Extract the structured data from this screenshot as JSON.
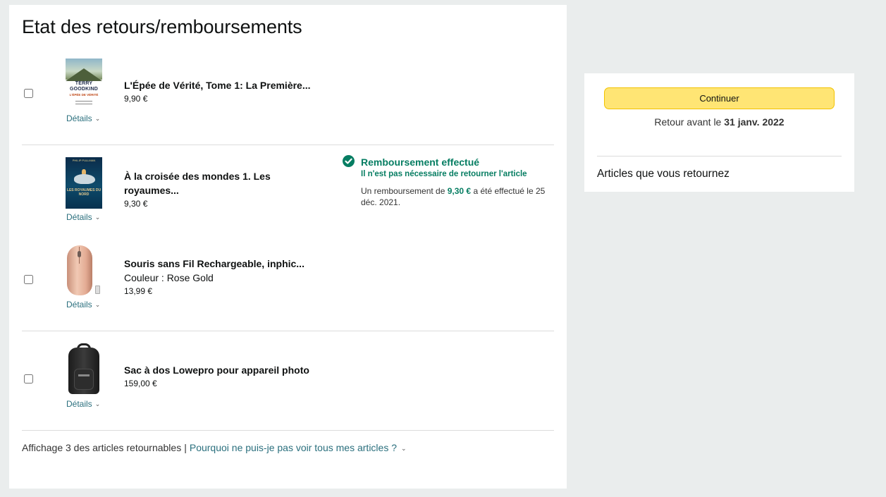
{
  "page": {
    "title": "Etat des retours/remboursements"
  },
  "items": [
    {
      "title": "L'Épée de Vérité, Tome 1: La Première...",
      "price": "9,90 €",
      "details": "Détails",
      "thumb_text": {
        "author": "TERRY GOODKIND",
        "title": "L'ÉPÉE DE VÉRITÉ"
      }
    },
    {
      "title": "À la croisée des mondes 1. Les royaumes...",
      "price": "9,30 €",
      "details": "Détails",
      "thumb_text": {
        "author": "PHILIP PULLMAN",
        "title": "LES ROYAUMES DU NORD"
      }
    },
    {
      "title": "Souris sans Fil Rechargeable, inphic...",
      "variant": "Couleur : Rose Gold",
      "price": "13,99 €",
      "details": "Détails"
    },
    {
      "title": "Sac à dos Lowepro pour appareil photo",
      "price": "159,00 €",
      "details": "Détails"
    }
  ],
  "refund": {
    "title": "Remboursement effectué",
    "subtitle": "Il n'est pas nécessaire de retourner l'article",
    "message_prefix": "Un remboursement de ",
    "amount": "9,30 €",
    "message_suffix": " a été effectué le 25 déc. 2021."
  },
  "footer": {
    "count_text": "Affichage 3 des articles retournables",
    "separator": "|",
    "why_link": "Pourquoi ne puis-je pas voir tous mes articles ?"
  },
  "side": {
    "continue_label": "Continuer",
    "return_by_prefix": "Retour avant le ",
    "return_by_date": "31 janv. 2022",
    "section_title": "Articles que vous retournez"
  },
  "colors": {
    "accent_green": "#067d62",
    "link_teal": "#2a6f7d",
    "button_yellow": "#ffe574",
    "page_bg": "#eaeded"
  },
  "icons": {
    "checkmark": "check-circle-icon",
    "chevron": "chevron-down-icon"
  }
}
